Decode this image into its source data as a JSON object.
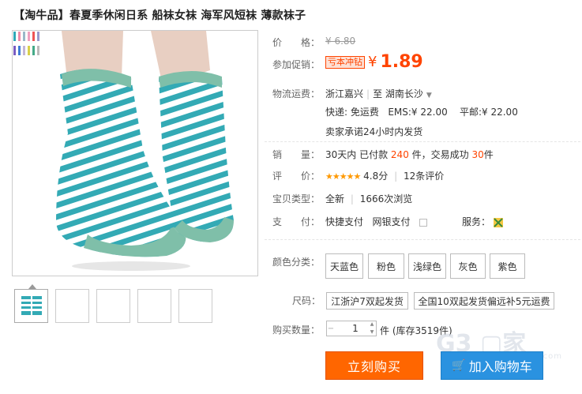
{
  "title": "【淘牛品】春夏季休闲日系 船袜女袜 海军风短袜 薄款袜子",
  "swatch_colors": [
    [
      "#2fa9b7",
      "#f08aa8",
      "#9ab8c8",
      "#f0a0c0",
      "#e55",
      "#99c"
    ],
    [
      "#7a5cc2",
      "#3e7bd6",
      "#c4b6d6",
      "#d9d04a",
      "#4a8",
      "#bbb"
    ]
  ],
  "price": {
    "label": "价　　格：",
    "old": "¥ 6.80"
  },
  "promo": {
    "label": "参加促销：",
    "badge": "亏本冲钻",
    "yen": "¥",
    "price": "1.89"
  },
  "shipping": {
    "label": "物流运费：",
    "from": "浙江嘉兴",
    "to_prefix": "至",
    "to": "湖南长沙",
    "express": "快递: 免运费",
    "ems": "EMS:¥ 22.00",
    "post": "平邮:¥ 22.00",
    "promise": "卖家承诺24小时内发货"
  },
  "sales": {
    "label": "销　　量：",
    "prefix": "30天内 已付款",
    "paid": "240",
    "middle": "件，交易成功",
    "success": "30",
    "suffix": "件"
  },
  "rating": {
    "label": "评　　价：",
    "stars": "★★★★★",
    "score": "4.8分",
    "reviews": "12条评价"
  },
  "item_type": {
    "label": "宝贝类型：",
    "condition": "全新",
    "views": "1666次浏览"
  },
  "payment": {
    "label": "支　　付：",
    "methods": [
      "快捷支付",
      "网银支付"
    ],
    "service_label": "服务："
  },
  "colors": {
    "label": "颜色分类：",
    "options": [
      "天蓝色",
      "粉色",
      "浅绿色",
      "灰色",
      "紫色"
    ]
  },
  "size": {
    "label": "尺码：",
    "options": [
      "江浙沪7双起发货",
      "全国10双起发货偏远补5元运费"
    ]
  },
  "quantity": {
    "label": "购买数量：",
    "value": "1",
    "stock": "件 (库存3519件)"
  },
  "buttons": {
    "buy_now": "立刻购买",
    "add_cart": "加入购物车"
  },
  "watermark": {
    "text": "G3 ▢家",
    "sub": "myhome3000.com"
  }
}
